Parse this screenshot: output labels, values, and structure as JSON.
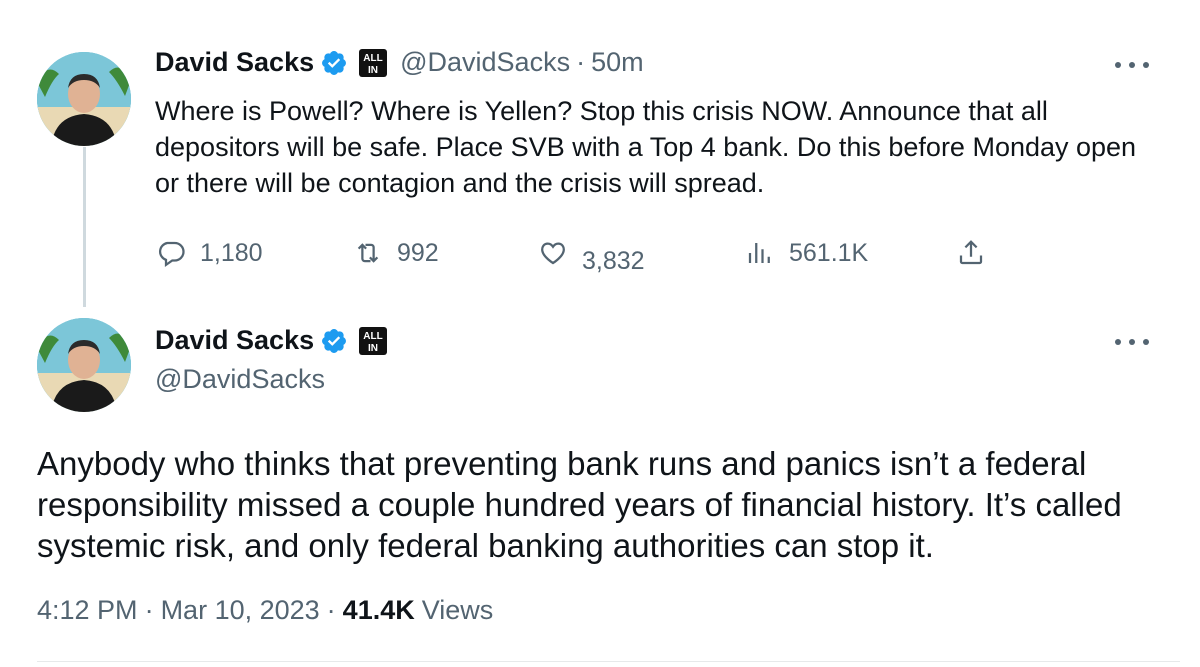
{
  "tweet1": {
    "name": "David Sacks",
    "handle": "@DavidSacks",
    "separator": "·",
    "time": "50m",
    "text": "Where is Powell? Where is Yellen? Stop this crisis NOW. Announce that all depositors will be safe. Place SVB with a Top 4 bank. Do this before Monday open or there will be contagion and the crisis will spread.",
    "replies": "1,180",
    "retweets": "992",
    "likes": "3,832",
    "views": "561.1K"
  },
  "tweet2": {
    "name": "David Sacks",
    "handle": "@DavidSacks",
    "text": "Anybody who thinks that preventing bank runs and panics isn’t a federal responsibility missed a couple hundred years of financial history. It’s called systemic risk, and only federal banking authorities can stop it.",
    "time": "4:12 PM",
    "separator1": "·",
    "date": "Mar 10, 2023",
    "separator2": "·",
    "views_count": "41.4K",
    "views_label": "Views"
  },
  "badge_text": [
    "ALL",
    "IN"
  ],
  "colors": {
    "verified_blue": "#1d9bf0",
    "secondary_text": "#536471",
    "primary_text": "#0f1419"
  },
  "icons": [
    "verified-icon",
    "all-in-badge-icon",
    "more-icon",
    "reply-icon",
    "retweet-icon",
    "like-icon",
    "views-icon",
    "share-icon"
  ]
}
